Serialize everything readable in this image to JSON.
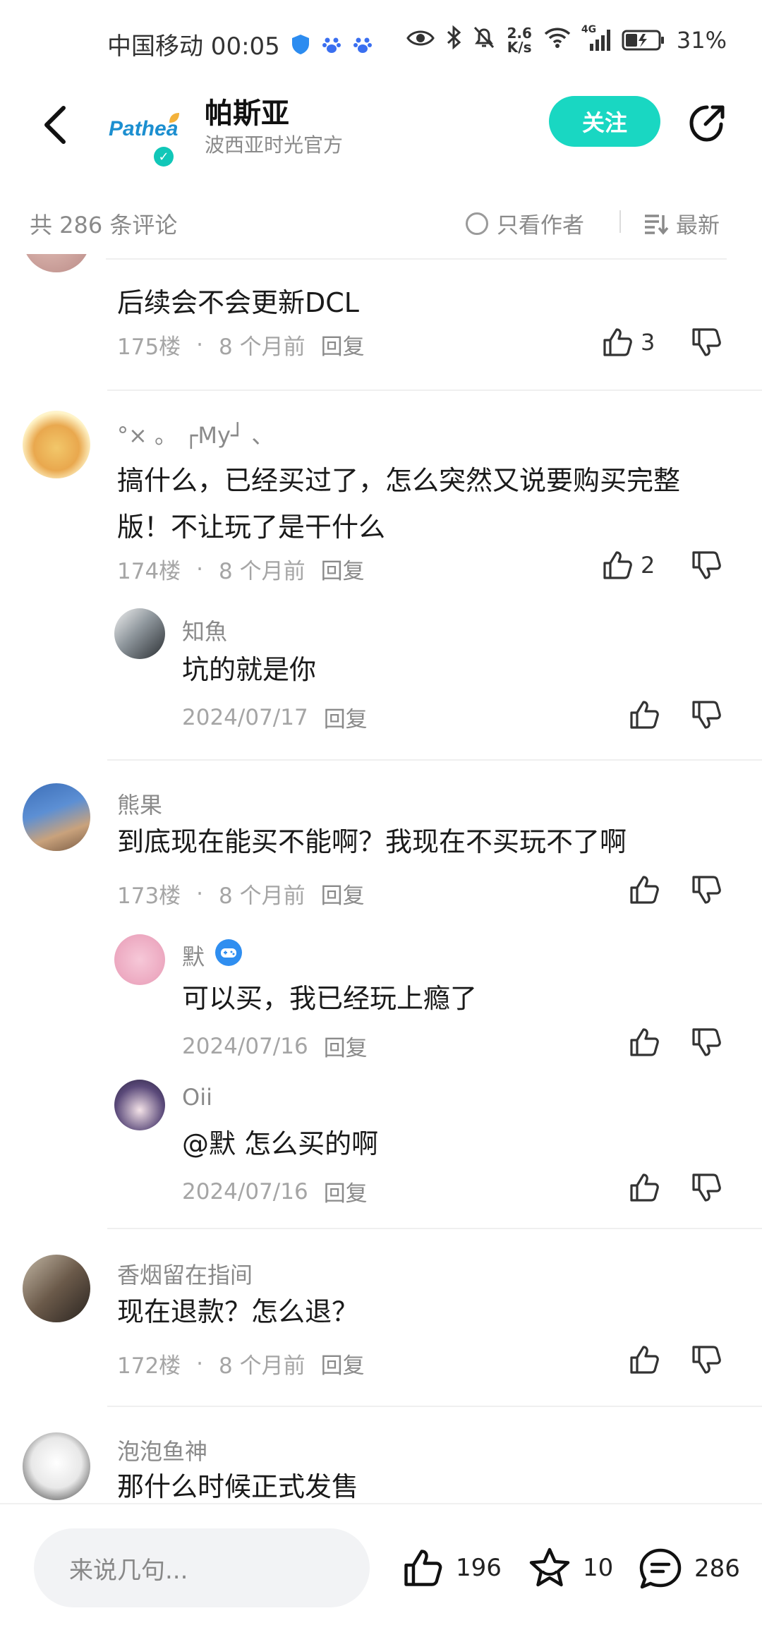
{
  "status_bar": {
    "carrier_time": "中国移动 00:05",
    "net_speed_value": "2.6",
    "net_speed_unit": "K/s",
    "network": "4G",
    "battery": "31%"
  },
  "header": {
    "logo_text": "Pathea",
    "title": "帕斯亚",
    "subtitle": "波西亚时光官方",
    "follow_label": "关注"
  },
  "sort_bar": {
    "total": "共 286 条评论",
    "author_only": "只看作者",
    "latest": "最新"
  },
  "comments": [
    {
      "text": "后续会不会更新DCL",
      "floor": "175楼",
      "time": "8 个月前",
      "reply": "回复",
      "likes": "3"
    },
    {
      "user": "°× 。 ┌My┘ 、",
      "text": "搞什么，已经买过了，怎么突然又说要购买完整版！不让玩了是干什么",
      "floor": "174楼",
      "time": "8 个月前",
      "reply": "回复",
      "likes": "2",
      "replies": [
        {
          "user": "知魚",
          "text": "坑的就是你",
          "time": "2024/07/17",
          "reply": "回复"
        }
      ]
    },
    {
      "user": "熊果",
      "text": "到底现在能买不能啊？我现在不买玩不了啊",
      "floor": "173楼",
      "time": "8 个月前",
      "reply": "回复",
      "replies": [
        {
          "user": "默",
          "text": "可以买，我已经玩上瘾了",
          "time": "2024/07/16",
          "reply": "回复"
        },
        {
          "user": "Oii",
          "text": "@默  怎么买的啊",
          "time": "2024/07/16",
          "reply": "回复"
        }
      ]
    },
    {
      "user": "香烟留在指间",
      "text": "现在退款？怎么退？",
      "floor": "172楼",
      "time": "8 个月前",
      "reply": "回复"
    },
    {
      "user": "泡泡鱼神",
      "text": "那什么时候正式发售"
    }
  ],
  "bottom_bar": {
    "input_placeholder": "来说几句...",
    "likes": "196",
    "favorites": "10",
    "comments": "286"
  },
  "colors": {
    "accent": "#19d7c2",
    "text_secondary": "#8a8a8a"
  }
}
